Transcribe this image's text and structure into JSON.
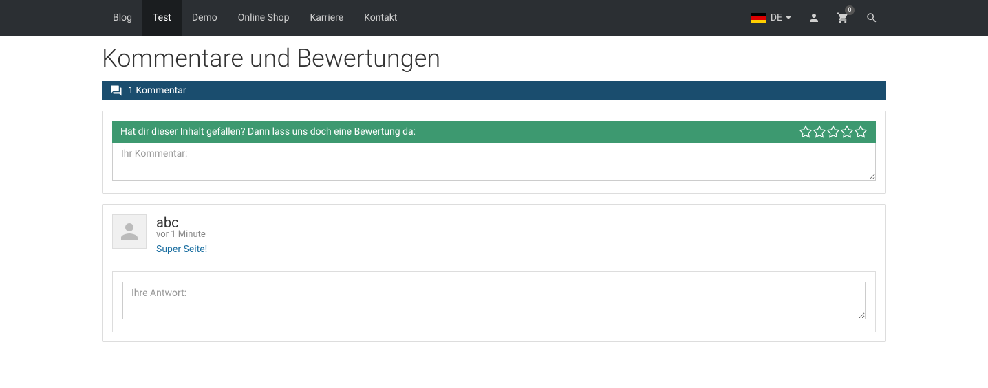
{
  "nav": {
    "items": [
      {
        "label": "Blog",
        "active": false
      },
      {
        "label": "Test",
        "active": true
      },
      {
        "label": "Demo",
        "active": false
      },
      {
        "label": "Online Shop",
        "active": false
      },
      {
        "label": "Karriere",
        "active": false
      },
      {
        "label": "Kontakt",
        "active": false
      }
    ],
    "language": "DE",
    "cart_count": "0"
  },
  "page": {
    "bg_title": "Kommentare",
    "section_title": "Kommentare und Bewertungen",
    "comment_count_label": "1 Kommentar"
  },
  "rating": {
    "prompt": "Hat dir dieser Inhalt gefallen? Dann lass uns doch eine Bewertung da:",
    "comment_placeholder": "Ihr Kommentar:"
  },
  "comments": [
    {
      "author": "abc",
      "time": "vor 1 Minute",
      "text": "Super Seite!"
    }
  ],
  "reply": {
    "placeholder": "Ihre Antwort:"
  }
}
